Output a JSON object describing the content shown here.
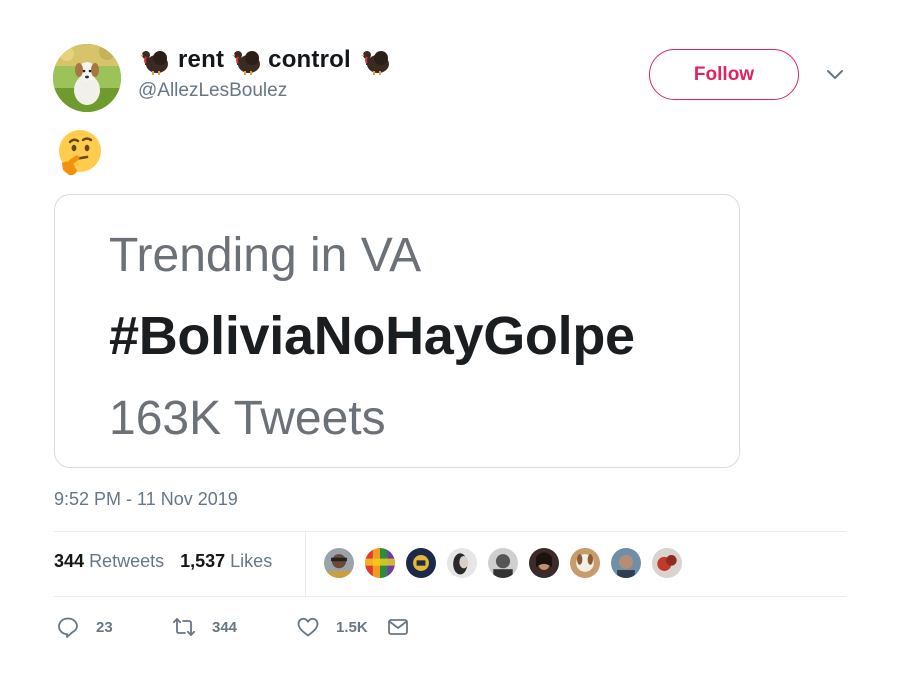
{
  "user": {
    "display_name_part1": "rent",
    "display_name_part2": "control",
    "handle": "@AllezLesBoulez",
    "name_emoji": "turkey-icon"
  },
  "follow_button": {
    "label": "Follow",
    "color": "#e0245e"
  },
  "tweet": {
    "text_emoji": "thinking-face-icon",
    "image_card": {
      "line1": "Trending in VA",
      "line2": "#BoliviaNoHayGolpe",
      "line3": "163K Tweets"
    },
    "timestamp": "9:52 PM - 11 Nov 2019"
  },
  "stats": {
    "retweets_count": "344",
    "retweets_label": "Retweets",
    "likes_count": "1,537",
    "likes_label": "Likes"
  },
  "actions": {
    "reply_count": "23",
    "retweet_count": "344",
    "like_count": "1.5K"
  },
  "colors": {
    "secondary_text": "#657786",
    "primary_text": "#14171a",
    "divider": "#e6ecf0"
  }
}
